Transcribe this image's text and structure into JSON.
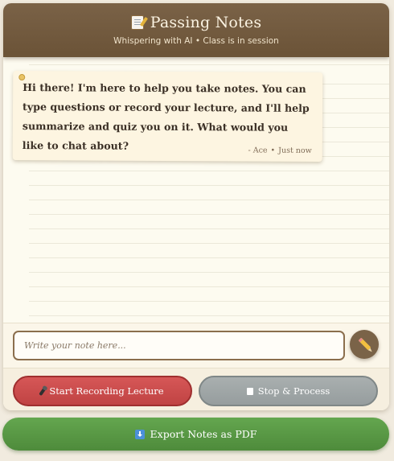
{
  "header": {
    "title": "Passing Notes",
    "title_icon": "memo-icon",
    "subtitle": "Whispering with AI • Class is in session"
  },
  "messages": [
    {
      "text": "Hi there! I'm here to help you take notes. You can type questions or record your lecture, and I'll help summarize and quiz you on it. What would you like to chat about?",
      "author": "- Ace",
      "separator": "•",
      "time": "Just now"
    }
  ],
  "composer": {
    "placeholder": "Write your note here...",
    "value": "",
    "send_icon": "pencil-icon"
  },
  "controls": {
    "record_label": "Start Recording Lecture",
    "record_icon": "microphone-icon",
    "stop_label": "Stop & Process",
    "stop_icon": "stop-icon"
  },
  "export": {
    "label": "Export Notes as PDF",
    "icon": "download-icon"
  },
  "colors": {
    "header": "#6b5337",
    "record": "#c94b4b",
    "stop": "#a0a7a8",
    "export": "#5a9a45",
    "note": "#fdf5e1"
  }
}
